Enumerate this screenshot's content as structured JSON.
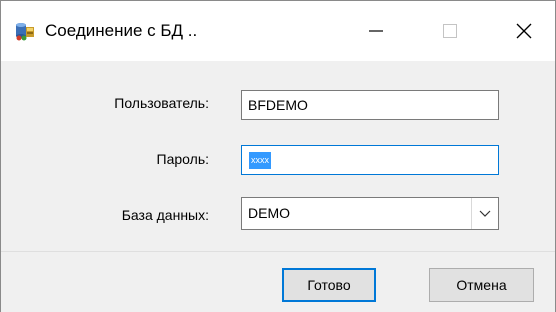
{
  "window": {
    "title": "Соединение с БД ..",
    "icon": "database-app-icon",
    "controls": {
      "minimize": "minimize-icon",
      "maximize": "maximize-icon",
      "close": "close-icon"
    }
  },
  "form": {
    "user": {
      "label": "Пользователь:",
      "value": "BFDEMO"
    },
    "password": {
      "label": "Пароль:",
      "value": "xxxx"
    },
    "database": {
      "label": "База данных:",
      "value": "DEMO"
    }
  },
  "buttons": {
    "ok": "Готово",
    "cancel": "Отмена"
  },
  "colors": {
    "accent": "#0078d7",
    "selection": "#3399ff",
    "dialog_bg": "#f0f0f0",
    "titlebar_bg": "#ffffff"
  }
}
